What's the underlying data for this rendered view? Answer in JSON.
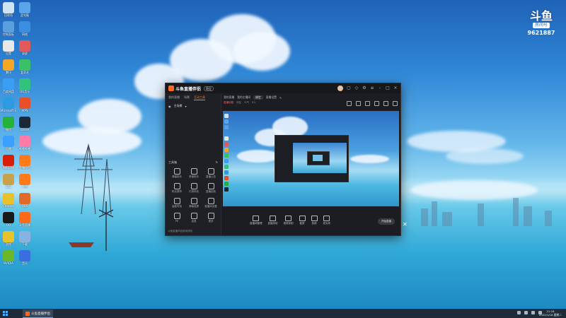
{
  "watermark": {
    "logo": "斗鱼",
    "tag": "房间号",
    "room": "9621887"
  },
  "desktop": {
    "icons": [
      {
        "label": "回收站",
        "color": "#cfe3f5"
      },
      {
        "label": "此电脑",
        "color": "#58a6e8"
      },
      {
        "label": "控制面板",
        "color": "#5aa0e0"
      },
      {
        "label": "网络",
        "color": "#3b8fe0"
      },
      {
        "label": "设置",
        "color": "#e8e8e8"
      },
      {
        "label": "录屏",
        "color": "#e05a5a"
      },
      {
        "label": "腾讯",
        "color": "#f5a623"
      },
      {
        "label": "爱奇艺",
        "color": "#3cc065"
      },
      {
        "label": "百度网盘",
        "color": "#3a9ff2"
      },
      {
        "label": "QQ音乐",
        "color": "#31c27c"
      },
      {
        "label": "Microsoft Edge",
        "color": "#2d9be0"
      },
      {
        "label": "WPS",
        "color": "#e8502a"
      },
      {
        "label": "微信",
        "color": "#23b23a"
      },
      {
        "label": "Steam",
        "color": "#1b2838"
      },
      {
        "label": "迅雷",
        "color": "#3aa0ff"
      },
      {
        "label": "哔哩哔哩",
        "color": "#ff7ca8"
      },
      {
        "label": "NetEase",
        "color": "#d81e06"
      },
      {
        "label": "直播伴侣",
        "color": "#ff7a1a"
      },
      {
        "label": "LOL",
        "color": "#c8a24a"
      },
      {
        "label": "斗鱼",
        "color": "#ff7a1a"
      },
      {
        "label": "Chrome",
        "color": "#e9c22a"
      },
      {
        "label": "OBS",
        "color": "#e06a2a"
      },
      {
        "label": "QQ",
        "color": "#1a1a1a"
      },
      {
        "label": "斗鱼直播",
        "color": "#ff6a1a"
      },
      {
        "label": "游戏",
        "color": "#e8c22a"
      },
      {
        "label": "下载",
        "color": "#8ab2e0"
      },
      {
        "label": "NVIDIA",
        "color": "#6ab82a"
      },
      {
        "label": "音乐",
        "color": "#3a6ee0"
      }
    ]
  },
  "app": {
    "title": "斗鱼直播伴侣",
    "version": "稳定",
    "left_tabs": [
      "我的直播",
      "场景",
      "互动工具"
    ],
    "active_tab": 2,
    "scene_label": "主场景",
    "tools_title": "工具箱",
    "tools": [
      "弹幕助手",
      "房管助手",
      "直播公告",
      "粉丝徽章",
      "礼物特效",
      "直播回放",
      "高能时刻",
      "弹幕投屏",
      "直播间设置",
      "PK",
      "连麦",
      "更多"
    ],
    "footer_text": "斗鱼直播伴侣使用须知",
    "top_line1": [
      "我的直播",
      "我的主播间",
      "直播设置"
    ],
    "top_pill": "绑定",
    "top_line2": [
      "直播标题",
      "分区",
      "人气",
      "0人"
    ],
    "rec_items": [
      "直播间管理",
      "直播录制",
      "视频录制",
      "截屏",
      "音频",
      "麦克风"
    ],
    "start_label": "开始直播"
  },
  "taskbar": {
    "app_label": "斗鱼直播伴侣",
    "time": "21:16",
    "date": "2022/1/18 星期二"
  }
}
